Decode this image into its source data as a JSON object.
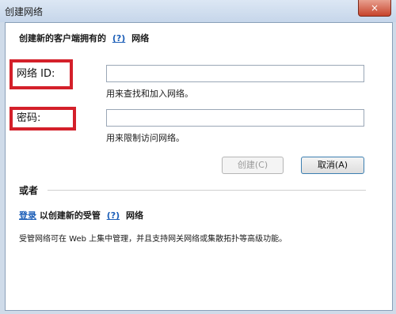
{
  "window": {
    "title": "创建网络",
    "close_glyph": "×"
  },
  "heading": {
    "prefix": "创建新的客户端拥有的",
    "help": "(?)",
    "suffix": "网络"
  },
  "network_id": {
    "label": "网络 ID:",
    "value": "",
    "hint": "用来查找和加入网络。"
  },
  "password": {
    "label": "密码:",
    "value": "",
    "hint": "用来限制访问网络。"
  },
  "buttons": {
    "create": "创建(C)",
    "cancel": "取消(A)"
  },
  "or_label": "或者",
  "signin": {
    "link": "登录",
    "middle": "以创建新的受管",
    "help": "(?)",
    "suffix": "网络"
  },
  "description": "受管网络可在 Web 上集中管理，并且支持网关网络或集散拓扑等高级功能。",
  "colors": {
    "highlight": "#d4202a",
    "link": "#1d5fb8"
  }
}
